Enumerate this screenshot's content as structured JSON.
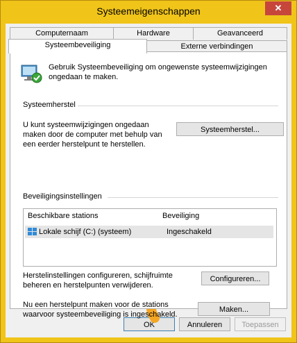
{
  "window": {
    "title": "Systeemeigenschappen",
    "close_glyph": "✕"
  },
  "tabs": {
    "row1": [
      "Computernaam",
      "Hardware",
      "Geavanceerd"
    ],
    "row2": [
      "Systeembeveiliging",
      "Externe verbindingen"
    ],
    "active": "Systeembeveiliging"
  },
  "intro": {
    "text": "Gebruik Systeembeveiliging om ongewenste systeemwijzigingen ongedaan te maken.",
    "icon": "system-protection-icon"
  },
  "restore": {
    "group_title": "Systeemherstel",
    "description": "U kunt systeemwijzigingen ongedaan maken door de computer met behulp van een eerder herstelpunt te herstellen.",
    "button": "Systeemherstel..."
  },
  "protection": {
    "group_title": "Beveiligingsinstellingen",
    "columns": [
      "Beschikbare stations",
      "Beveiliging"
    ],
    "rows": [
      {
        "station": "Lokale schijf (C:) (systeem)",
        "status": "Ingeschakeld",
        "icon": "drive-icon"
      }
    ],
    "configure_text": "Herstelinstellingen configureren, schijfruimte beheren en herstelpunten verwijderen.",
    "configure_button": "Configureren...",
    "create_text": "Nu een herstelpunt maken voor de stations waarvoor systeembeveiliging is ingeschakeld.",
    "create_button": "Maken..."
  },
  "footer": {
    "ok": "OK",
    "cancel": "Annuleren",
    "apply": "Toepassen"
  },
  "colors": {
    "frame": "#f0c419",
    "close": "#c7463c",
    "accent_arrow": "#f5a623",
    "selection": "#e5e5e5"
  }
}
